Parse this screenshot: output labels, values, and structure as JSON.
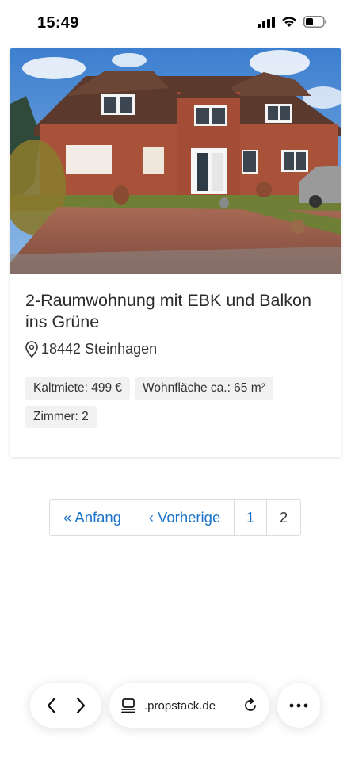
{
  "status_bar": {
    "time": "15:49",
    "icons": [
      "cellular-signal-icon",
      "wifi-icon",
      "battery-icon"
    ]
  },
  "listing": {
    "photo": {
      "icon": "house-photo",
      "colors": {
        "sky": "#4f8fd6",
        "brick": "#a9523a",
        "roof": "#5a3a2c",
        "lawn": "#7b8b3a",
        "paving": "#9c5b49"
      }
    },
    "title": "2-Raumwohnung mit EBK und Balkon ins Grüne",
    "location_icon": "map-pin-icon",
    "location": "18442 Steinhagen",
    "tags": [
      "Kaltmiete: 499 €",
      "Wohnfläche ca.: 65 m²",
      "Zimmer: 2"
    ]
  },
  "pagination": {
    "first": "« Anfang",
    "previous": "‹ Vorherige",
    "pages": [
      "1",
      "2"
    ],
    "current_page": "2",
    "link_color": "#1a73c8"
  },
  "browser_toolbar": {
    "back_icon": "chevron-left-icon",
    "forward_icon": "chevron-right-icon",
    "tabs_icon": "tab-overview-icon",
    "url": ".propstack.de",
    "reload_icon": "reload-icon",
    "more_icon": "more-dots-icon"
  }
}
